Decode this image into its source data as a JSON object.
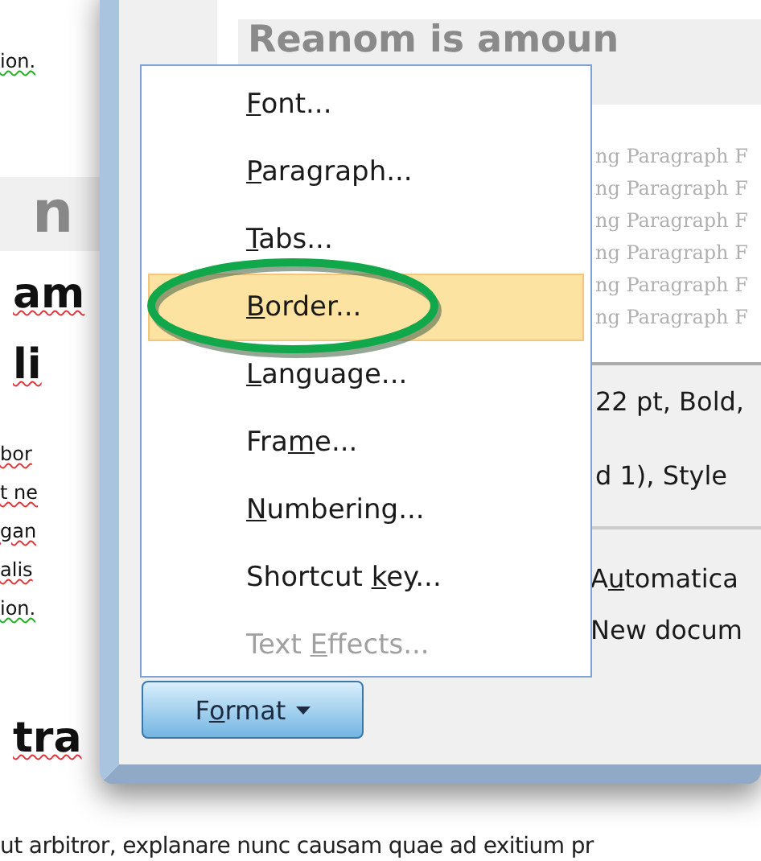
{
  "document": {
    "side_lines": [
      {
        "kind": "body",
        "text": "ion."
      },
      {
        "kind": "title",
        "text": "n"
      },
      {
        "kind": "heading",
        "text": "am"
      },
      {
        "kind": "heading",
        "text": "li"
      },
      {
        "kind": "body",
        "text": "bor"
      },
      {
        "kind": "body",
        "text": "t ne"
      },
      {
        "kind": "body",
        "text": "gan"
      },
      {
        "kind": "body",
        "text": "alis"
      },
      {
        "kind": "body",
        "text": "ion."
      },
      {
        "kind": "heading",
        "text": "tra"
      }
    ],
    "bottom_line": "ut arbitror, explanare nunc causam quae ad exitium pr"
  },
  "dialog": {
    "preview": {
      "heading": "Reanom is amoun",
      "lines": [
        "ng Paragraph F",
        "ng Paragraph F",
        "ng Paragraph F",
        "ng Paragraph F",
        "ng Paragraph F",
        "ng Paragraph F"
      ]
    },
    "description": [
      "22 pt, Bold,",
      "d 1), Style"
    ],
    "options": [
      {
        "start": "A",
        "accel": "u",
        "end": "tomatica"
      },
      {
        "start": "New docum"
      }
    ],
    "format_button": {
      "start": "F",
      "accel": "o",
      "end": "rmat"
    }
  },
  "format_menu": {
    "items": [
      {
        "accel": "F",
        "end": "ont...",
        "selected": false,
        "disabled": false
      },
      {
        "accel": "P",
        "end": "aragraph...",
        "selected": false,
        "disabled": false
      },
      {
        "accel": "T",
        "end": "abs...",
        "selected": false,
        "disabled": false
      },
      {
        "accel": "B",
        "end": "order...",
        "selected": true,
        "disabled": false
      },
      {
        "accel": "L",
        "end": "anguage...",
        "selected": false,
        "disabled": false
      },
      {
        "start": "Fra",
        "accel": "m",
        "end": "e...",
        "selected": false,
        "disabled": false
      },
      {
        "accel": "N",
        "end": "umbering...",
        "selected": false,
        "disabled": false
      },
      {
        "start": "Shortcut ",
        "accel": "k",
        "end": "ey...",
        "selected": false,
        "disabled": false
      },
      {
        "start": "Text ",
        "accel": "E",
        "end": "ffects...",
        "selected": false,
        "disabled": true
      }
    ]
  },
  "annotation": {
    "kind": "ellipse"
  }
}
